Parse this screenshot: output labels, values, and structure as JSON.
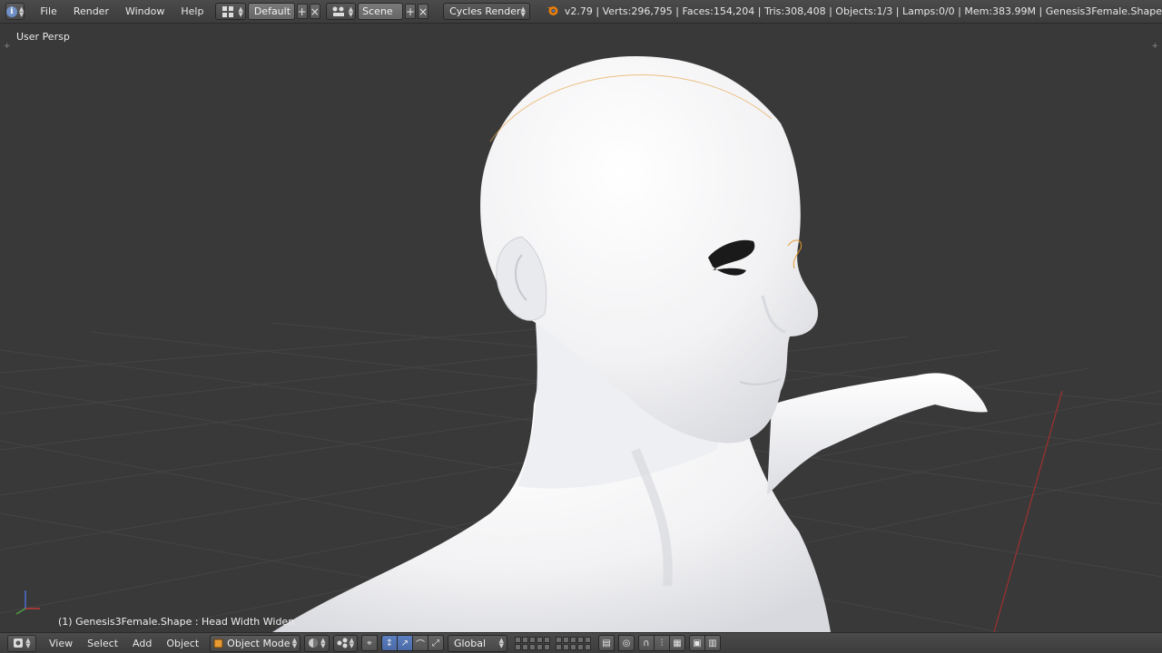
{
  "header": {
    "menus": [
      "File",
      "Render",
      "Window",
      "Help"
    ],
    "layout": "Default",
    "scene": "Scene",
    "render_engine": "Cycles Render",
    "stats": "v2.79 | Verts:296,795 | Faces:154,204 | Tris:308,408 | Objects:1/3 | Lamps:0/0 | Mem:383.99M | Genesis3Female.Shape"
  },
  "viewport": {
    "view_label": "User Persp",
    "object_label": "(1) Genesis3Female.Shape : Head Width Widen"
  },
  "footer": {
    "menus": [
      "View",
      "Select",
      "Add",
      "Object"
    ],
    "mode": "Object Mode",
    "orientation": "Global"
  },
  "colors": {
    "header_bg": "#434343",
    "viewport_bg": "#393939",
    "grid": "#444444",
    "active_blue": "#5a7fc0",
    "selection_orange": "#e69a2e",
    "x_axis_red": "#a03030"
  }
}
